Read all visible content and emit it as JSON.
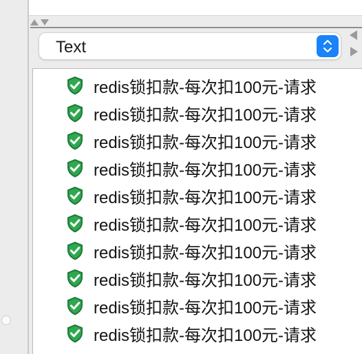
{
  "selector": {
    "selected": "Text"
  },
  "results": {
    "items": [
      {
        "label": "redis锁扣款-每次扣100元-请求",
        "status": "success"
      },
      {
        "label": "redis锁扣款-每次扣100元-请求",
        "status": "success"
      },
      {
        "label": "redis锁扣款-每次扣100元-请求",
        "status": "success"
      },
      {
        "label": "redis锁扣款-每次扣100元-请求",
        "status": "success"
      },
      {
        "label": "redis锁扣款-每次扣100元-请求",
        "status": "success"
      },
      {
        "label": "redis锁扣款-每次扣100元-请求",
        "status": "success"
      },
      {
        "label": "redis锁扣款-每次扣100元-请求",
        "status": "success"
      },
      {
        "label": "redis锁扣款-每次扣100元-请求",
        "status": "success"
      },
      {
        "label": "redis锁扣款-每次扣100元-请求",
        "status": "success"
      },
      {
        "label": "redis锁扣款-每次扣100元-请求",
        "status": "success"
      }
    ]
  },
  "colors": {
    "accent": "#1a82fb",
    "success_shield": "#2fa84f",
    "panel_bg": "#ececec"
  },
  "icons": {
    "success": "shield-check-icon",
    "select_toggle": "chevron-up-down-icon",
    "sort_up": "sort-up-icon",
    "sort_down": "sort-down-icon",
    "collapse": "collapse-left-icon",
    "expand": "expand-right-icon"
  }
}
